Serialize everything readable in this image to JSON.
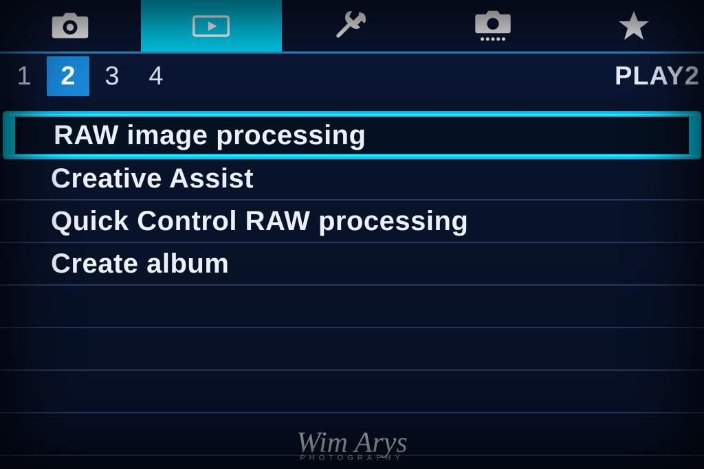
{
  "categoryTabs": [
    {
      "name": "shooting",
      "icon": "camera-icon",
      "active": false
    },
    {
      "name": "playback",
      "icon": "play-icon",
      "active": true
    },
    {
      "name": "setup",
      "icon": "wrench-icon",
      "active": false
    },
    {
      "name": "custom",
      "icon": "custom-camera-icon",
      "active": false
    },
    {
      "name": "mymenu",
      "icon": "star-icon",
      "active": false
    }
  ],
  "pageTabs": {
    "numbers": [
      "1",
      "2",
      "3",
      "4"
    ],
    "activeIndex": 1,
    "label": "PLAY2"
  },
  "menuItems": [
    {
      "label": "RAW image processing",
      "selected": true
    },
    {
      "label": "Creative Assist",
      "selected": false
    },
    {
      "label": "Quick Control RAW processing",
      "selected": false
    },
    {
      "label": "Create album",
      "selected": false
    }
  ],
  "emptyRows": 4,
  "watermark": {
    "main": "Wim Arys",
    "sub": "PHOTOGRAPHY"
  },
  "colors": {
    "accent": "#00c8e8",
    "highlight": "#1888d8",
    "background": "#0a1530",
    "text": "#ecf0f8"
  }
}
